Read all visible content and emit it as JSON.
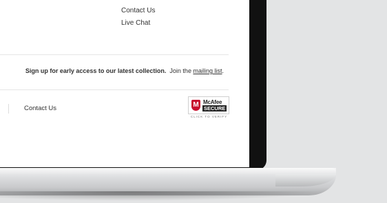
{
  "footer": {
    "contact_us_top": "Contact Us",
    "live_chat": "Live Chat",
    "signup_bold": "Sign up for early access to our latest collection.",
    "signup_join": "Join the",
    "signup_link": "mailing list",
    "signup_period": ".",
    "contact_us_bottom": "Contact Us"
  },
  "badge": {
    "brand": "McAfee",
    "secure": "SECURE",
    "shield_letter": "M",
    "verify_text": "CLICK TO VERIFY"
  },
  "colors": {
    "brand_red": "#c8102e",
    "bezel": "#111111",
    "page_bg": "#ffffff",
    "wall": "#e3e4e5"
  }
}
